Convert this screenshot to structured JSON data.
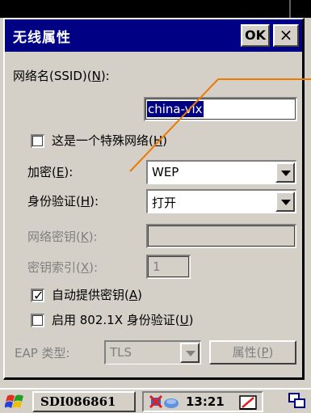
{
  "dialog": {
    "title": "无线属性",
    "ok_label": "OK",
    "close_label": "×"
  },
  "ssid": {
    "label_pre": "网络名(SSID)(",
    "label_key": "N",
    "label_post": "):",
    "value": "china-vlx"
  },
  "special_network": {
    "label_pre": "这是一个特殊网络(",
    "label_key": "H",
    "label_post": ")",
    "checked": false
  },
  "encryption": {
    "label_pre": "加密(",
    "label_key": "E",
    "label_post": "):",
    "value": "WEP"
  },
  "authentication": {
    "label_pre": "身份验证(",
    "label_key": "H",
    "label_post": "):",
    "value": "打开"
  },
  "network_key": {
    "label_pre": "网络密钥(",
    "label_key": "K",
    "label_post": "):",
    "value": ""
  },
  "key_index": {
    "label_pre": "密钥索引(",
    "label_key": "X",
    "label_post": "):",
    "value": "1"
  },
  "auto_key": {
    "label_pre": "自动提供密钥(",
    "label_key": "A",
    "label_post": ")",
    "checked": true,
    "mark": "✓"
  },
  "ieee8021x": {
    "label_pre": "启用 802.1X 身份验证(",
    "label_key": "U",
    "label_post": ")",
    "checked": false
  },
  "eap": {
    "label": "EAP 类型:",
    "value": "TLS",
    "properties_pre": "属性(",
    "properties_key": "P",
    "properties_post": ")"
  },
  "taskbar": {
    "task_label": "SDI086861",
    "clock": "13:21"
  },
  "colors": {
    "titlebar": "#000084",
    "annotation": "#f07800",
    "face": "#d4d0c8"
  }
}
